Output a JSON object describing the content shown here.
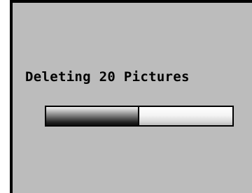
{
  "dialog": {
    "message": "Deleting 20 Pictures",
    "progress": 0.5
  }
}
